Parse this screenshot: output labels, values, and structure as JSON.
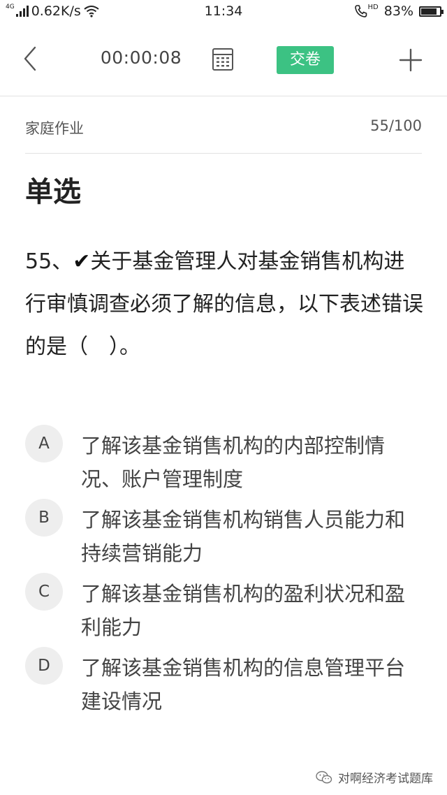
{
  "status_bar": {
    "network_tag": "4G",
    "speed": "0.62K/s",
    "time": "11:34",
    "hd_tag": "HD",
    "battery": "83%",
    "battery_level": 0.83
  },
  "toolbar": {
    "timer": "00:00:08",
    "submit_label": "交卷"
  },
  "info": {
    "category": "家庭作业",
    "progress": "55/100"
  },
  "question": {
    "type": "单选",
    "number": "55、",
    "check": "✔",
    "text": "关于基金管理人对基金销售机构进行审慎调查必须了解的信息，以下表述错误的是（　）。"
  },
  "options": [
    {
      "letter": "A",
      "text": "了解该基金销售机构的内部控制情况、账户管理制度"
    },
    {
      "letter": "B",
      "text": "了解该基金销售机构销售人员能力和持续营销能力"
    },
    {
      "letter": "C",
      "text": "了解该基金销售机构的盈利状况和盈利能力"
    },
    {
      "letter": "D",
      "text": "了解该基金销售机构的信息管理平台建设情况"
    }
  ],
  "watermark": {
    "text": "对啊经济考试题库"
  }
}
